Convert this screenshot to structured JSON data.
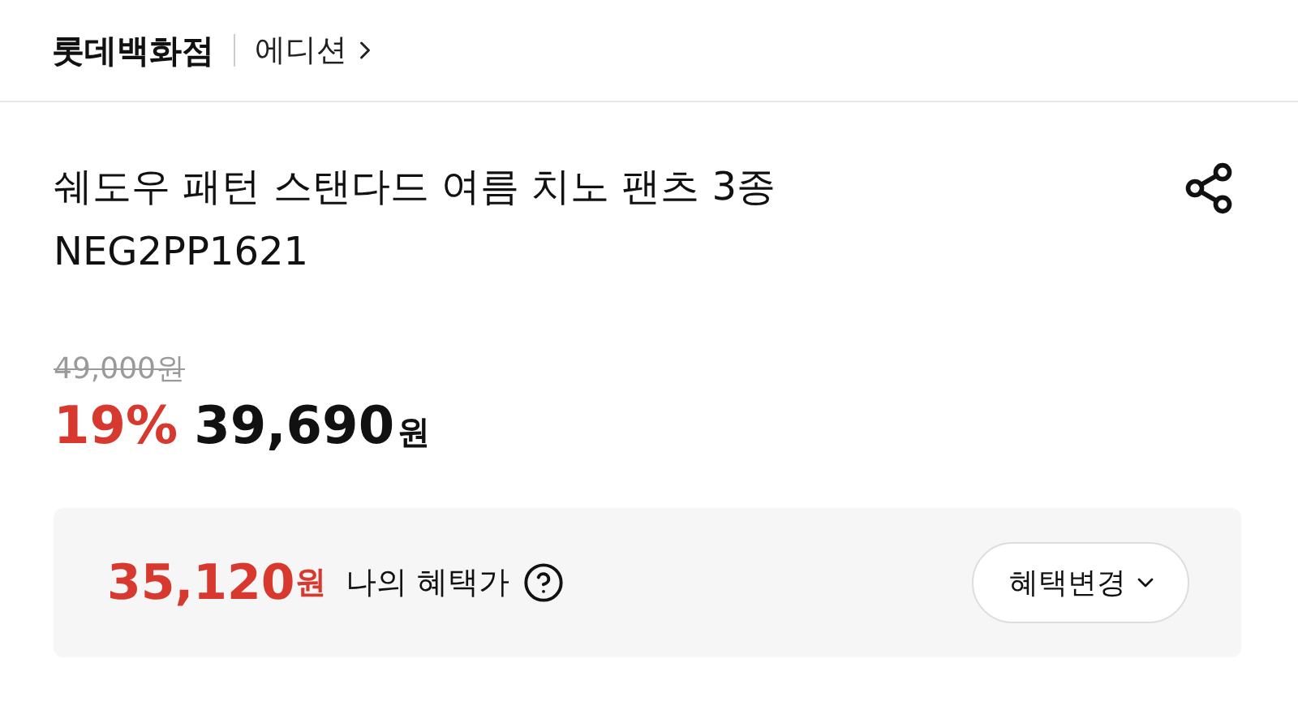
{
  "header": {
    "brand": "롯데백화점",
    "link": "에디션"
  },
  "product": {
    "title": "쉐도우 패턴 스탠다드 여름 치노 팬츠 3종",
    "code": "NEG2PP1621"
  },
  "price": {
    "original": "49,000",
    "original_unit": "원",
    "discount": "19%",
    "sale": "39,690",
    "sale_unit": "원"
  },
  "benefit": {
    "price": "35,120",
    "unit": "원",
    "label": "나의 혜택가",
    "button": "혜택변경"
  }
}
